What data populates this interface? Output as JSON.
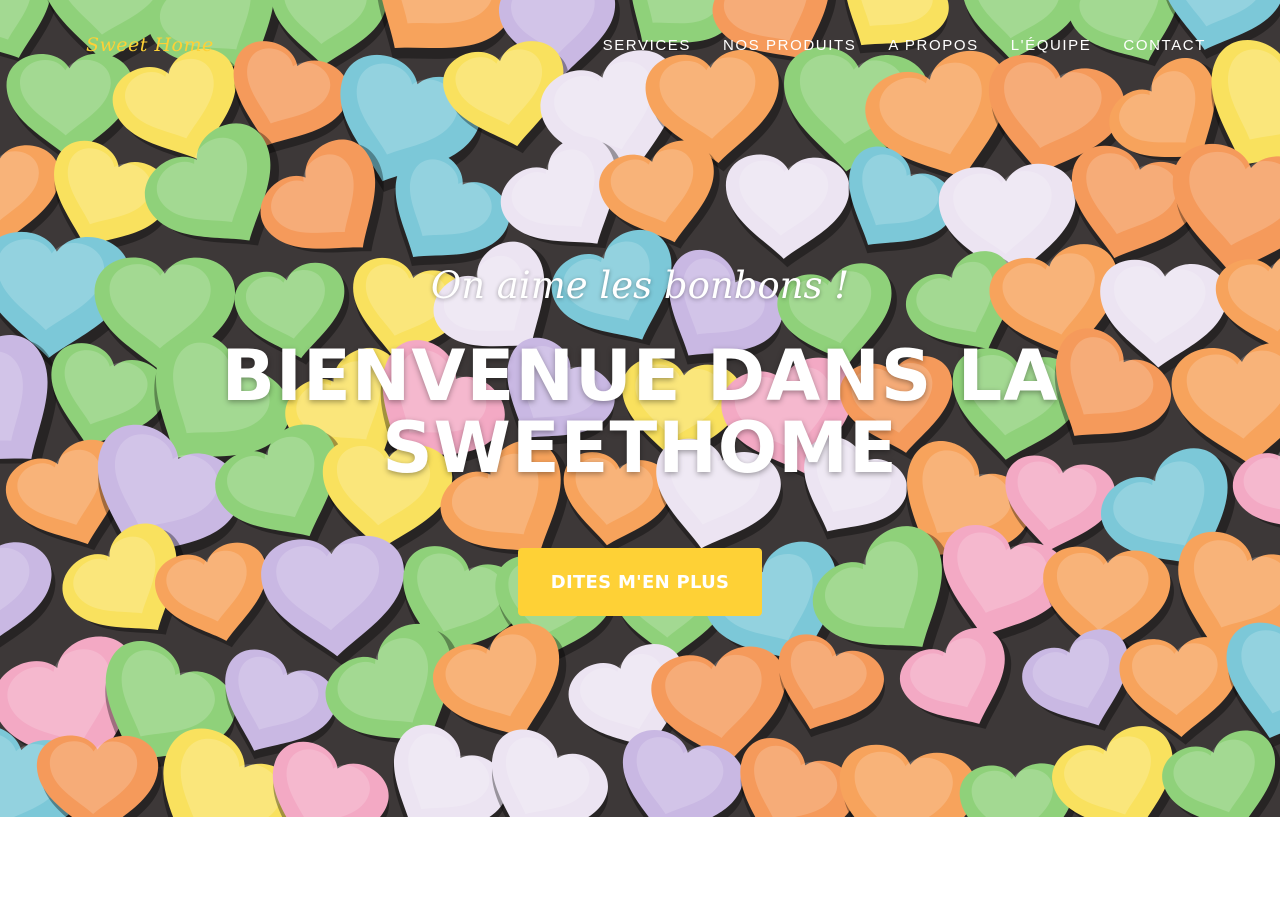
{
  "navbar": {
    "brand": "Sweet Home",
    "links": [
      "SERVICES",
      "NOS PRODUITS",
      "A PROPOS",
      "L'ÉQUIPE",
      "CONTACT"
    ]
  },
  "hero": {
    "subheading": "On aime les bonbons !",
    "heading": "BIENVENUE DANS LA SWEETHOME",
    "button_label": "DITES M'EN PLUS",
    "background_image": "candy-hearts-photo"
  },
  "colors": {
    "accent": "#fed136",
    "text": "#ffffff",
    "page_background": "#ffffff"
  }
}
